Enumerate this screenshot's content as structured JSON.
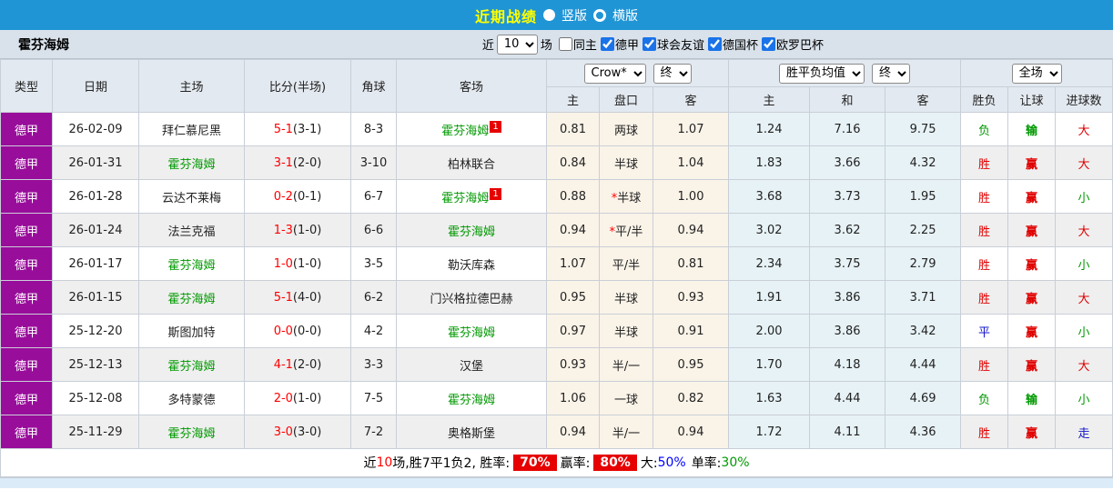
{
  "topbar": {
    "title": "近期战绩",
    "vertical_label": "竖版",
    "horizontal_label": "横版",
    "selected_view": "竖版"
  },
  "filterbar": {
    "team": "霍芬海姆",
    "recent_label": "近",
    "recent_count": "10",
    "unit_label": "场",
    "options": [
      {
        "label": "同主",
        "checked": false
      },
      {
        "label": "德甲",
        "checked": true
      },
      {
        "label": "球会友谊",
        "checked": true
      },
      {
        "label": "德国杯",
        "checked": true
      },
      {
        "label": "欧罗巴杯",
        "checked": true
      }
    ]
  },
  "table": {
    "headers": [
      "类型",
      "日期",
      "主场",
      "比分(半场)",
      "角球",
      "客场"
    ],
    "group_handicap": {
      "company_select": "Crow*",
      "time_select": "终",
      "cols": [
        "主",
        "盘口",
        "客"
      ]
    },
    "group_europe": {
      "type_select": "胜平负均值",
      "time_select": "终",
      "cols": [
        "主",
        "和",
        "客"
      ]
    },
    "group_result": {
      "scope_select": "全场",
      "cols": [
        "胜负",
        "让球",
        "进球数"
      ]
    },
    "rows": [
      {
        "league": "德甲",
        "date": "26-02-09",
        "home": "拜仁慕尼黑",
        "home_color": "black",
        "home_badge": "",
        "score": "5-1",
        "half": "(3-1)",
        "corners": "8-3",
        "away": "霍芬海姆",
        "away_color": "green",
        "away_badge": "1",
        "ah_home": "0.81",
        "ah_star": false,
        "ah_line": "两球",
        "ah_away": "1.07",
        "eu_home": "1.24",
        "eu_draw": "7.16",
        "eu_away": "9.75",
        "result": "负",
        "result_color": "green",
        "hr": "输",
        "hr_color": "green",
        "goals": "大",
        "goals_color": "red"
      },
      {
        "league": "德甲",
        "date": "26-01-31",
        "home": "霍芬海姆",
        "home_color": "green",
        "home_badge": "",
        "score": "3-1",
        "half": "(2-0)",
        "corners": "3-10",
        "away": "柏林联合",
        "away_color": "black",
        "away_badge": "",
        "ah_home": "0.84",
        "ah_star": false,
        "ah_line": "半球",
        "ah_away": "1.04",
        "eu_home": "1.83",
        "eu_draw": "3.66",
        "eu_away": "4.32",
        "result": "胜",
        "result_color": "red",
        "hr": "赢",
        "hr_color": "red",
        "goals": "大",
        "goals_color": "red"
      },
      {
        "league": "德甲",
        "date": "26-01-28",
        "home": "云达不莱梅",
        "home_color": "black",
        "home_badge": "",
        "score": "0-2",
        "half": "(0-1)",
        "corners": "6-7",
        "away": "霍芬海姆",
        "away_color": "green",
        "away_badge": "1",
        "ah_home": "0.88",
        "ah_star": true,
        "ah_line": "半球",
        "ah_away": "1.00",
        "eu_home": "3.68",
        "eu_draw": "3.73",
        "eu_away": "1.95",
        "result": "胜",
        "result_color": "red",
        "hr": "赢",
        "hr_color": "red",
        "goals": "小",
        "goals_color": "green"
      },
      {
        "league": "德甲",
        "date": "26-01-24",
        "home": "法兰克福",
        "home_color": "black",
        "home_badge": "",
        "score": "1-3",
        "half": "(1-0)",
        "corners": "6-6",
        "away": "霍芬海姆",
        "away_color": "green",
        "away_badge": "",
        "ah_home": "0.94",
        "ah_star": true,
        "ah_line": "平/半",
        "ah_away": "0.94",
        "eu_home": "3.02",
        "eu_draw": "3.62",
        "eu_away": "2.25",
        "result": "胜",
        "result_color": "red",
        "hr": "赢",
        "hr_color": "red",
        "goals": "大",
        "goals_color": "red"
      },
      {
        "league": "德甲",
        "date": "26-01-17",
        "home": "霍芬海姆",
        "home_color": "green",
        "home_badge": "",
        "score": "1-0",
        "half": "(1-0)",
        "corners": "3-5",
        "away": "勒沃库森",
        "away_color": "black",
        "away_badge": "",
        "ah_home": "1.07",
        "ah_star": false,
        "ah_line": "平/半",
        "ah_away": "0.81",
        "eu_home": "2.34",
        "eu_draw": "3.75",
        "eu_away": "2.79",
        "result": "胜",
        "result_color": "red",
        "hr": "赢",
        "hr_color": "red",
        "goals": "小",
        "goals_color": "green"
      },
      {
        "league": "德甲",
        "date": "26-01-15",
        "home": "霍芬海姆",
        "home_color": "green",
        "home_badge": "",
        "score": "5-1",
        "half": "(4-0)",
        "corners": "6-2",
        "away": "门兴格拉德巴赫",
        "away_color": "black",
        "away_badge": "",
        "ah_home": "0.95",
        "ah_star": false,
        "ah_line": "半球",
        "ah_away": "0.93",
        "eu_home": "1.91",
        "eu_draw": "3.86",
        "eu_away": "3.71",
        "result": "胜",
        "result_color": "red",
        "hr": "赢",
        "hr_color": "red",
        "goals": "大",
        "goals_color": "red"
      },
      {
        "league": "德甲",
        "date": "25-12-20",
        "home": "斯图加特",
        "home_color": "black",
        "home_badge": "",
        "score": "0-0",
        "half": "(0-0)",
        "corners": "4-2",
        "away": "霍芬海姆",
        "away_color": "green",
        "away_badge": "",
        "ah_home": "0.97",
        "ah_star": false,
        "ah_line": "半球",
        "ah_away": "0.91",
        "eu_home": "2.00",
        "eu_draw": "3.86",
        "eu_away": "3.42",
        "result": "平",
        "result_color": "blue",
        "hr": "赢",
        "hr_color": "red",
        "goals": "小",
        "goals_color": "green"
      },
      {
        "league": "德甲",
        "date": "25-12-13",
        "home": "霍芬海姆",
        "home_color": "green",
        "home_badge": "",
        "score": "4-1",
        "half": "(2-0)",
        "corners": "3-3",
        "away": "汉堡",
        "away_color": "black",
        "away_badge": "",
        "ah_home": "0.93",
        "ah_star": false,
        "ah_line": "半/一",
        "ah_away": "0.95",
        "eu_home": "1.70",
        "eu_draw": "4.18",
        "eu_away": "4.44",
        "result": "胜",
        "result_color": "red",
        "hr": "赢",
        "hr_color": "red",
        "goals": "大",
        "goals_color": "red"
      },
      {
        "league": "德甲",
        "date": "25-12-08",
        "home": "多特蒙德",
        "home_color": "black",
        "home_badge": "",
        "score": "2-0",
        "half": "(1-0)",
        "corners": "7-5",
        "away": "霍芬海姆",
        "away_color": "green",
        "away_badge": "",
        "ah_home": "1.06",
        "ah_star": false,
        "ah_line": "一球",
        "ah_away": "0.82",
        "eu_home": "1.63",
        "eu_draw": "4.44",
        "eu_away": "4.69",
        "result": "负",
        "result_color": "green",
        "hr": "输",
        "hr_color": "green",
        "goals": "小",
        "goals_color": "green"
      },
      {
        "league": "德甲",
        "date": "25-11-29",
        "home": "霍芬海姆",
        "home_color": "green",
        "home_badge": "",
        "score": "3-0",
        "half": "(3-0)",
        "corners": "7-2",
        "away": "奥格斯堡",
        "away_color": "black",
        "away_badge": "",
        "ah_home": "0.94",
        "ah_star": false,
        "ah_line": "半/一",
        "ah_away": "0.94",
        "eu_home": "1.72",
        "eu_draw": "4.11",
        "eu_away": "4.36",
        "result": "胜",
        "result_color": "red",
        "hr": "赢",
        "hr_color": "red",
        "goals": "走",
        "goals_color": "blue"
      }
    ]
  },
  "footer": {
    "prefix": "近",
    "count": "10",
    "segment1": "场,胜7平1负2, 胜率:",
    "win_rate": "70%",
    "segment2": "赢率:",
    "handicap_win_rate": "80%",
    "segment3": "大:",
    "big_rate": "50%",
    "segment4": "单率:",
    "single_rate": "30%"
  },
  "colors": {
    "topbar_blue": "#2095D5",
    "league_purple": "#990D9B",
    "win_red": "#E00000",
    "loss_green": "#009900",
    "draw_blue": "#1414CC",
    "title_yellow": "#FFFF00"
  }
}
